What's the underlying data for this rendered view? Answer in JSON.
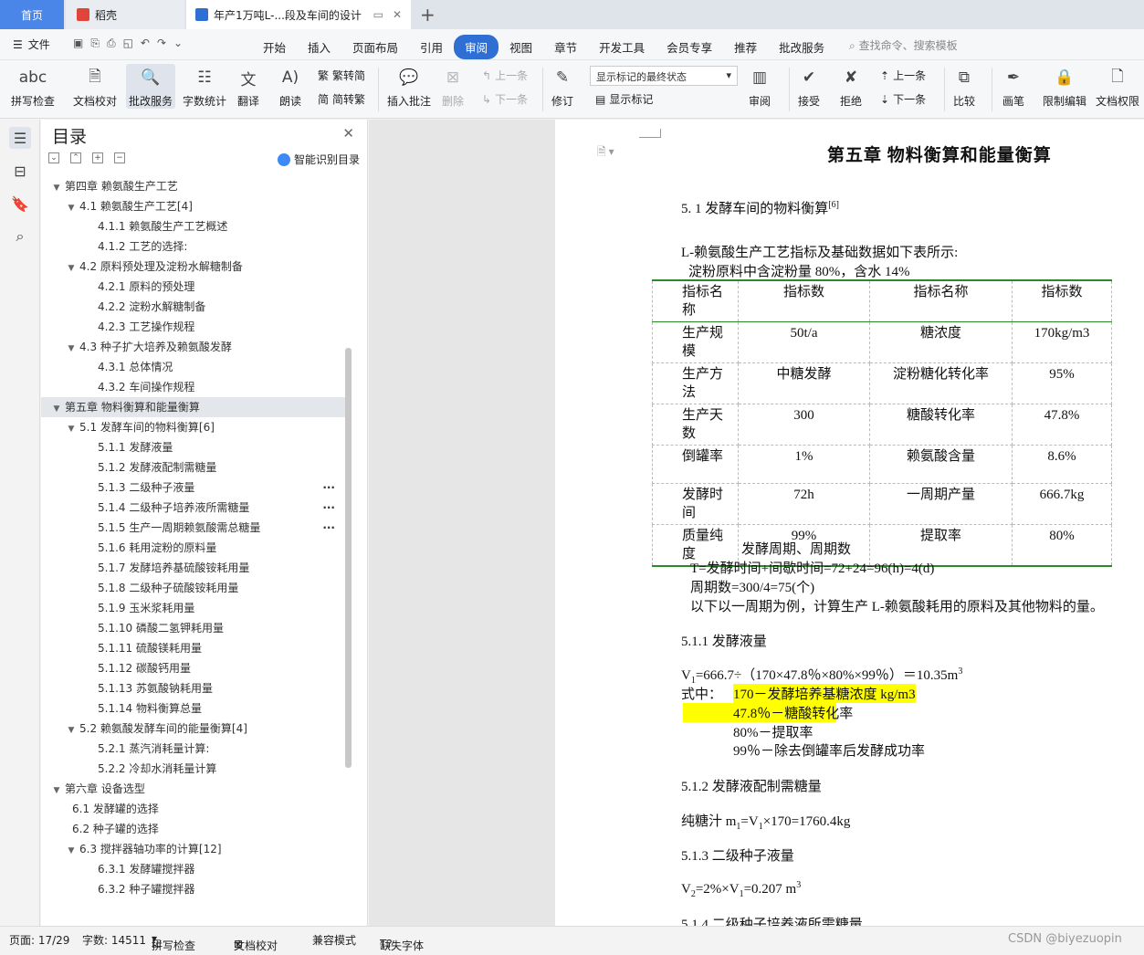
{
  "tabs": {
    "home": "首页",
    "doc1": "稻壳",
    "doc2": "年产1万吨L-...段及车间的设计"
  },
  "menu": {
    "file": "文件",
    "items": [
      "开始",
      "插入",
      "页面布局",
      "引用",
      "审阅",
      "视图",
      "章节",
      "开发工具",
      "会员专享",
      "推荐",
      "批改服务"
    ],
    "active_index": 4,
    "search_placeholder": "查找命令、搜索模板"
  },
  "toolbar": {
    "spell": "拼写检查",
    "doc_check": "文档校对",
    "correct_service": "批改服务",
    "word_count": "字数统计",
    "translate": "翻译",
    "read": "朗读",
    "to_traditional": "繁转简",
    "to_simplified": "简转繁",
    "insert_comment": "插入批注",
    "delete": "删除",
    "prev": "上一条",
    "next": "下一条",
    "revise": "修订",
    "markup_state": "显示标记的最终状态",
    "show_markup": "显示标记",
    "review": "审阅",
    "accept": "接受",
    "reject": "拒绝",
    "prev2": "上一条",
    "next2": "下一条",
    "compare": "比较",
    "pen": "画笔",
    "restrict": "限制编辑",
    "doc_perm": "文档权限"
  },
  "toc": {
    "title": "目录",
    "ai_label": "智能识别目录",
    "items": [
      {
        "label": "第四章    赖氨酸生产工艺",
        "level": 1,
        "chev": "v"
      },
      {
        "label": "4.1    赖氨酸生产工艺[4]",
        "level": 2,
        "chev": "v"
      },
      {
        "label": "4.1.1    赖氨酸生产工艺概述",
        "level": 3
      },
      {
        "label": "4.1.2    工艺的选择:",
        "level": 3
      },
      {
        "label": "4.2    原料预处理及淀粉水解糖制备",
        "level": 2,
        "chev": "v"
      },
      {
        "label": "4.2.1    原料的预处理",
        "level": 3
      },
      {
        "label": "4.2.2    淀粉水解糖制备",
        "level": 3
      },
      {
        "label": "4.2.3    工艺操作规程",
        "level": 3
      },
      {
        "label": "4.3    种子扩大培养及赖氨酸发酵",
        "level": 2,
        "chev": "v"
      },
      {
        "label": "4.3.1    总体情况",
        "level": 3
      },
      {
        "label": "4.3.2    车间操作规程",
        "level": 3
      },
      {
        "label": "第五章    物料衡算和能量衡算",
        "level": 1,
        "chev": "v",
        "selected": true
      },
      {
        "label": "5.1 发酵车间的物料衡算[6]",
        "level": 2,
        "chev": "v"
      },
      {
        "label": "5.1.1 发酵液量",
        "level": 3
      },
      {
        "label": "5.1.2 发酵液配制需糖量",
        "level": 3
      },
      {
        "label": "5.1.3 二级种子液量",
        "level": 3,
        "more": true
      },
      {
        "label": "5.1.4 二级种子培养液所需糖量",
        "level": 3,
        "more": true
      },
      {
        "label": "5.1.5 生产一周期赖氨酸需总糖量",
        "level": 3,
        "more": true
      },
      {
        "label": "5.1.6 耗用淀粉的原料量",
        "level": 3
      },
      {
        "label": "5.1.7 发酵培养基硫酸铵耗用量",
        "level": 3
      },
      {
        "label": "5.1.8 二级种子硫酸铵耗用量",
        "level": 3
      },
      {
        "label": "5.1.9 玉米浆耗用量",
        "level": 3
      },
      {
        "label": "5.1.10 磷酸二氢钾耗用量",
        "level": 3
      },
      {
        "label": "5.1.11 硫酸镁耗用量",
        "level": 3
      },
      {
        "label": "5.1.12 碳酸钙用量",
        "level": 3
      },
      {
        "label": "5.1.13 苏氨酸钠耗用量",
        "level": 3
      },
      {
        "label": "5.1.14 物料衡算总量",
        "level": 3
      },
      {
        "label": "5.2 赖氨酸发酵车间的能量衡算[4]",
        "level": 2,
        "chev": "v"
      },
      {
        "label": "5.2.1 蒸汽消耗量计算:",
        "level": 3
      },
      {
        "label": "5.2.2 冷却水消耗量计算",
        "level": 3
      },
      {
        "label": "第六章    设备选型",
        "level": 1,
        "chev": "v"
      },
      {
        "label": "6.1 发酵罐的选择",
        "level": 2
      },
      {
        "label": "6.2 种子罐的选择",
        "level": 2
      },
      {
        "label": "6.3 搅拌器轴功率的计算[12]",
        "level": 2,
        "chev": "v"
      },
      {
        "label": "6.3.1 发酵罐搅拌器",
        "level": 3
      },
      {
        "label": "6.3.2 种子罐搅拌器",
        "level": 3
      }
    ]
  },
  "doc": {
    "chapter": "第五章      物料衡算和能量衡算",
    "sec51": "5. 1 发酵车间的物料衡算",
    "sec51_ref": "[6]",
    "intro": "L-赖氨酸生产工艺指标及基础数据如下表所示:",
    "starch": "淀粉原料中含淀粉量 80%，含水 14%",
    "table": {
      "header": [
        "指标名称",
        "指标数",
        "指标名称",
        "指标数"
      ],
      "rows": [
        [
          "生产规模",
          "50t/a",
          "糖浓度",
          "170kg/m3"
        ],
        [
          "生产方法",
          "中糖发酵",
          "淀粉糖化转化率",
          "95%"
        ],
        [
          "生产天数",
          "300",
          "糖酸转化率",
          "47.8%"
        ],
        [
          "倒罐率",
          "1%",
          "赖氨酸含量",
          "8.6%"
        ],
        [
          "发酵时间",
          "72h",
          "一周期产量",
          "666.7kg"
        ],
        [
          "质量纯度",
          "99%",
          "提取率",
          "80%"
        ]
      ]
    },
    "cycle_title": "发酵周期、周期数",
    "cycle_t": "T=发酵时间+间歇时间=72+24=96(h)=4(d)",
    "cycle_n": "周期数=300/4=75(个)",
    "cycle_note": "以下以一周期为例，计算生产 L-赖氨酸耗用的原料及其他物料的量。",
    "sec511": "5.1.1 发酵液量",
    "v1_formula": "=666.7÷（170×47.8％×80%×99％）＝10.35m",
    "where": "式中：",
    "w1": "170－发酵培养基糖浓度 kg/m3",
    "w2": "47.8％－糖酸转化率",
    "w3": "80%－提取率",
    "w4": "99％－除去倒罐率后发酵成功率",
    "sec512": "5.1.2  发酵液配制需糖量",
    "m1_formula_a": "纯糖汁 m",
    "m1_formula_b": "=V",
    "m1_formula_c": "×170=1760.4kg",
    "sec513": "5.1.3  二级种子液量",
    "v2_formula": "=2%×V",
    "v2_formula_b": "=0.207 m",
    "sec514": "5.1.4  二级种子培养液所需糖量"
  },
  "status": {
    "page": "页面: 17/29",
    "words": "字数: 14511",
    "spell": "拼写检查",
    "doc_check": "文档校对",
    "compat": "兼容模式",
    "missing_font": "缺失字体",
    "watermark": "CSDN @biyezuopin"
  }
}
